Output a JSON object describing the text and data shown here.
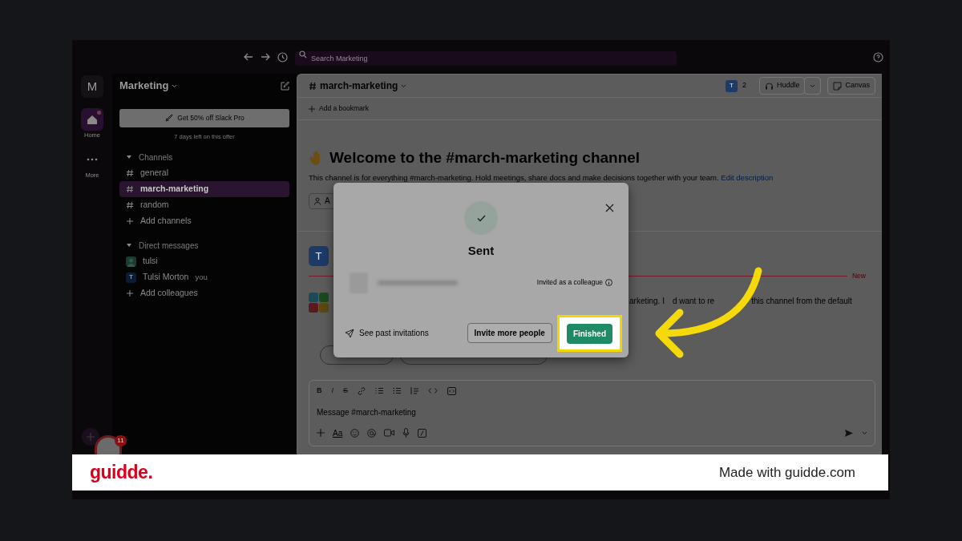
{
  "topbar": {
    "search": {
      "placeholder": "Search Marketing"
    }
  },
  "rail": {
    "workspace_initial": "M",
    "items": [
      {
        "label": "Home",
        "selected": true,
        "unread": true
      },
      {
        "label": "More",
        "selected": false,
        "unread": false
      }
    ]
  },
  "sidebar": {
    "workspace": "Marketing",
    "promo": {
      "label": "Get 50% off Slack Pro",
      "note": "7 days left on this offer"
    },
    "sections": [
      {
        "title": "Channels",
        "expanded": true,
        "items": [
          {
            "kind": "channel",
            "label": "general",
            "selected": false
          },
          {
            "kind": "channel",
            "label": "march-marketing",
            "selected": true
          },
          {
            "kind": "channel",
            "label": "random",
            "selected": false
          },
          {
            "kind": "add",
            "label": "Add channels",
            "selected": false
          }
        ]
      },
      {
        "title": "Direct messages",
        "expanded": true,
        "items": [
          {
            "kind": "dm",
            "label": "tulsi",
            "selected": false
          },
          {
            "kind": "dm",
            "label": "Tulsi Morton",
            "note": "you",
            "avatar": "T",
            "selected": false
          },
          {
            "kind": "add",
            "label": "Add colleagues",
            "selected": false
          }
        ]
      }
    ]
  },
  "channel": {
    "name": "march-marketing",
    "member_avatar": "T",
    "member_count": "2",
    "huddle": "Huddle",
    "canvas": "Canvas",
    "bookmark": "Add a bookmark"
  },
  "welcome": {
    "title": "Welcome to the #march-marketing channel",
    "description": "This channel is for everything #march-marketing. Hold meetings, share docs and make decisions together with your team.",
    "link": "Edit description",
    "button": "A"
  },
  "messages": {
    "first_avatar": "T",
    "divider": "New",
    "text_pieces": [
      "arketing. I",
      "d want to re",
      "this channel from the default"
    ]
  },
  "composer": {
    "format": [
      "B",
      "I",
      "S"
    ],
    "placeholder": "Message #march-marketing",
    "text_style": "Aa"
  },
  "modal": {
    "title": "Sent",
    "role": "Invited as a colleague",
    "link": "See past invitations",
    "buttons": [
      {
        "kind": "secondary",
        "label": "Invite more people",
        "highlighted": false
      },
      {
        "kind": "primary",
        "label": "Finished",
        "highlighted": true
      }
    ]
  },
  "notifications": {
    "count": "11"
  },
  "footer": {
    "brand": "guidde.",
    "credit": "Made with guidde.com"
  }
}
